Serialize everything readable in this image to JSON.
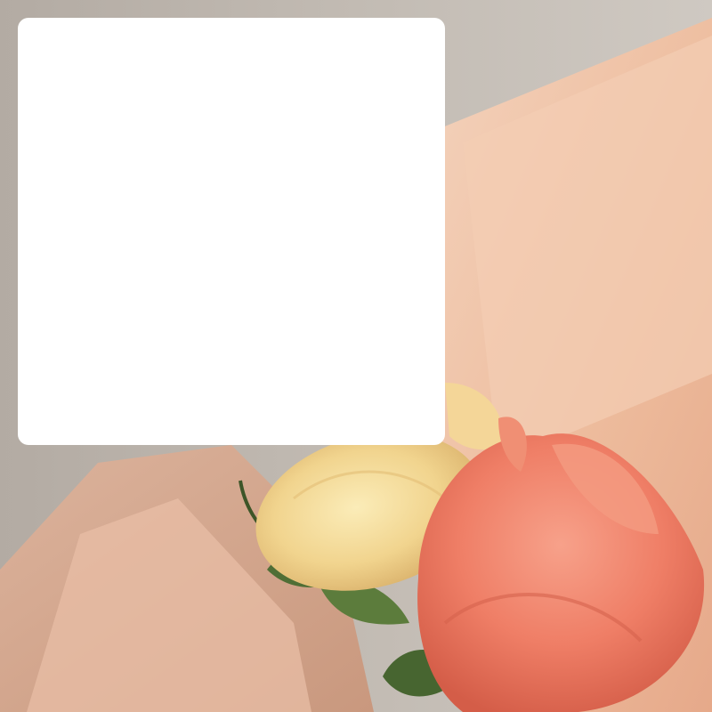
{
  "background_photo": {
    "subject": "two-roses-icon",
    "colors": {
      "wall": "#b7b0a8",
      "tissue_paper": "#efc3a6",
      "yellow_rose": "#f3d89a",
      "coral_rose": "#ef7e66",
      "leaves": "#4f6e35"
    }
  },
  "overlay_card": {
    "color": "#ffffff"
  }
}
